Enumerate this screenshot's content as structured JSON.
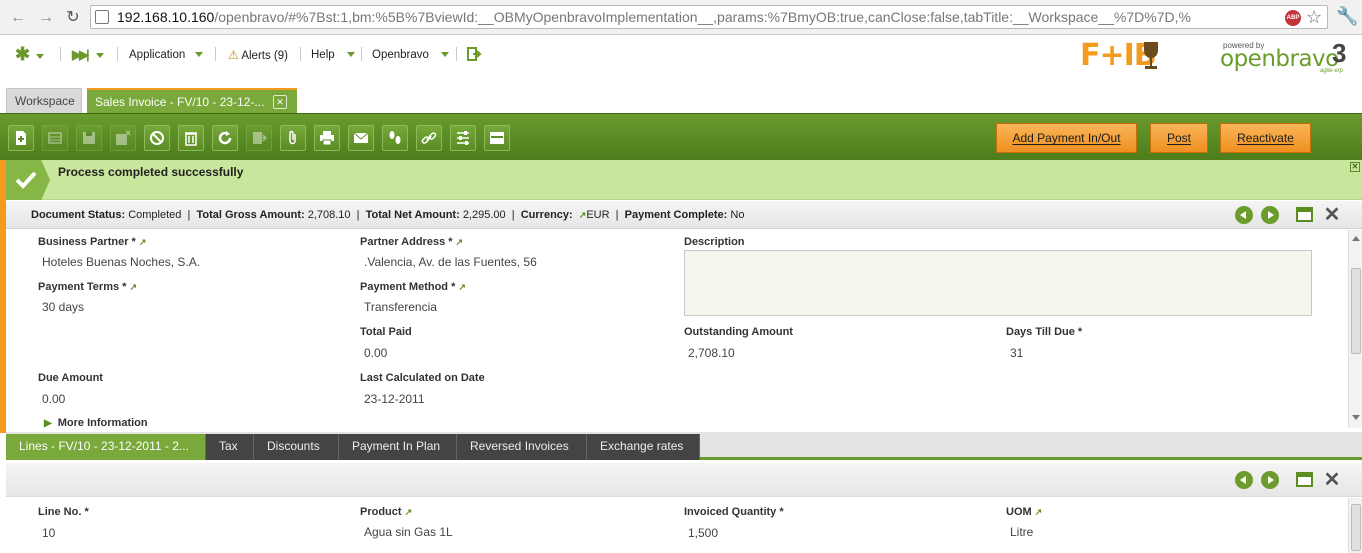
{
  "browser": {
    "url_host": "192.168.10.160",
    "url_path": "/openbravo/#%7Bst:1,bm:%5B%7BviewId:__OBMyOpenbravoImplementation__,params:%7BmyOB:true,canClose:false,tabTitle:__Workspace__%7D%7D,%",
    "abp_label": "ABP"
  },
  "menu": {
    "application": "Application",
    "alerts": "Alerts (9)",
    "help": "Help",
    "openbravo": "Openbravo"
  },
  "logo": {
    "fb_text": "F+IB",
    "powered_by": "powered by",
    "brand": "openbravo",
    "version": "3",
    "tagline": "agile erp"
  },
  "tabs": {
    "workspace": "Workspace",
    "invoice": "Sales Invoice - FV/10 - 23-12-..."
  },
  "actions": {
    "add_payment": "Add Payment In/Out",
    "post": "Post",
    "reactivate": "Reactivate"
  },
  "message": {
    "text": "Process completed successfully"
  },
  "status": {
    "doc_status_label": "Document Status:",
    "doc_status_value": "Completed",
    "gross_label": "Total Gross Amount:",
    "gross_value": "2,708.10",
    "net_label": "Total Net Amount:",
    "net_value": "2,295.00",
    "currency_label": "Currency:",
    "currency_value": "EUR",
    "payment_complete_label": "Payment Complete:",
    "payment_complete_value": "No"
  },
  "form": {
    "business_partner_label": "Business Partner *",
    "business_partner_value": "Hoteles Buenas Noches, S.A.",
    "partner_address_label": "Partner Address *",
    "partner_address_value": ".Valencia, Av. de las Fuentes, 56",
    "description_label": "Description",
    "payment_terms_label": "Payment Terms *",
    "payment_terms_value": "30 days",
    "payment_method_label": "Payment Method *",
    "payment_method_value": "Transferencia",
    "total_paid_label": "Total Paid",
    "total_paid_value": "0.00",
    "outstanding_label": "Outstanding Amount",
    "outstanding_value": "2,708.10",
    "days_till_due_label": "Days Till Due *",
    "days_till_due_value": "31",
    "due_amount_label": "Due Amount",
    "due_amount_value": "0.00",
    "last_calc_label": "Last Calculated on Date",
    "last_calc_value": "23-12-2011",
    "more_info": "More Information"
  },
  "subtabs": {
    "lines": "Lines - FV/10 - 23-12-2011 - 2...",
    "tax": "Tax",
    "discounts": "Discounts",
    "payment_plan": "Payment In Plan",
    "reversed": "Reversed Invoices",
    "exchange": "Exchange rates"
  },
  "lines": {
    "line_no_label": "Line No. *",
    "line_no_value": "10",
    "product_label": "Product",
    "product_value": "Agua sin Gas 1L",
    "qty_label": "Invoiced Quantity *",
    "qty_value": "1,500",
    "uom_label": "UOM",
    "uom_value": "Litre"
  },
  "colors": {
    "brand_green": "#6a9b2f",
    "accent_orange": "#f39a1f",
    "success_bg": "#c8e69c"
  }
}
